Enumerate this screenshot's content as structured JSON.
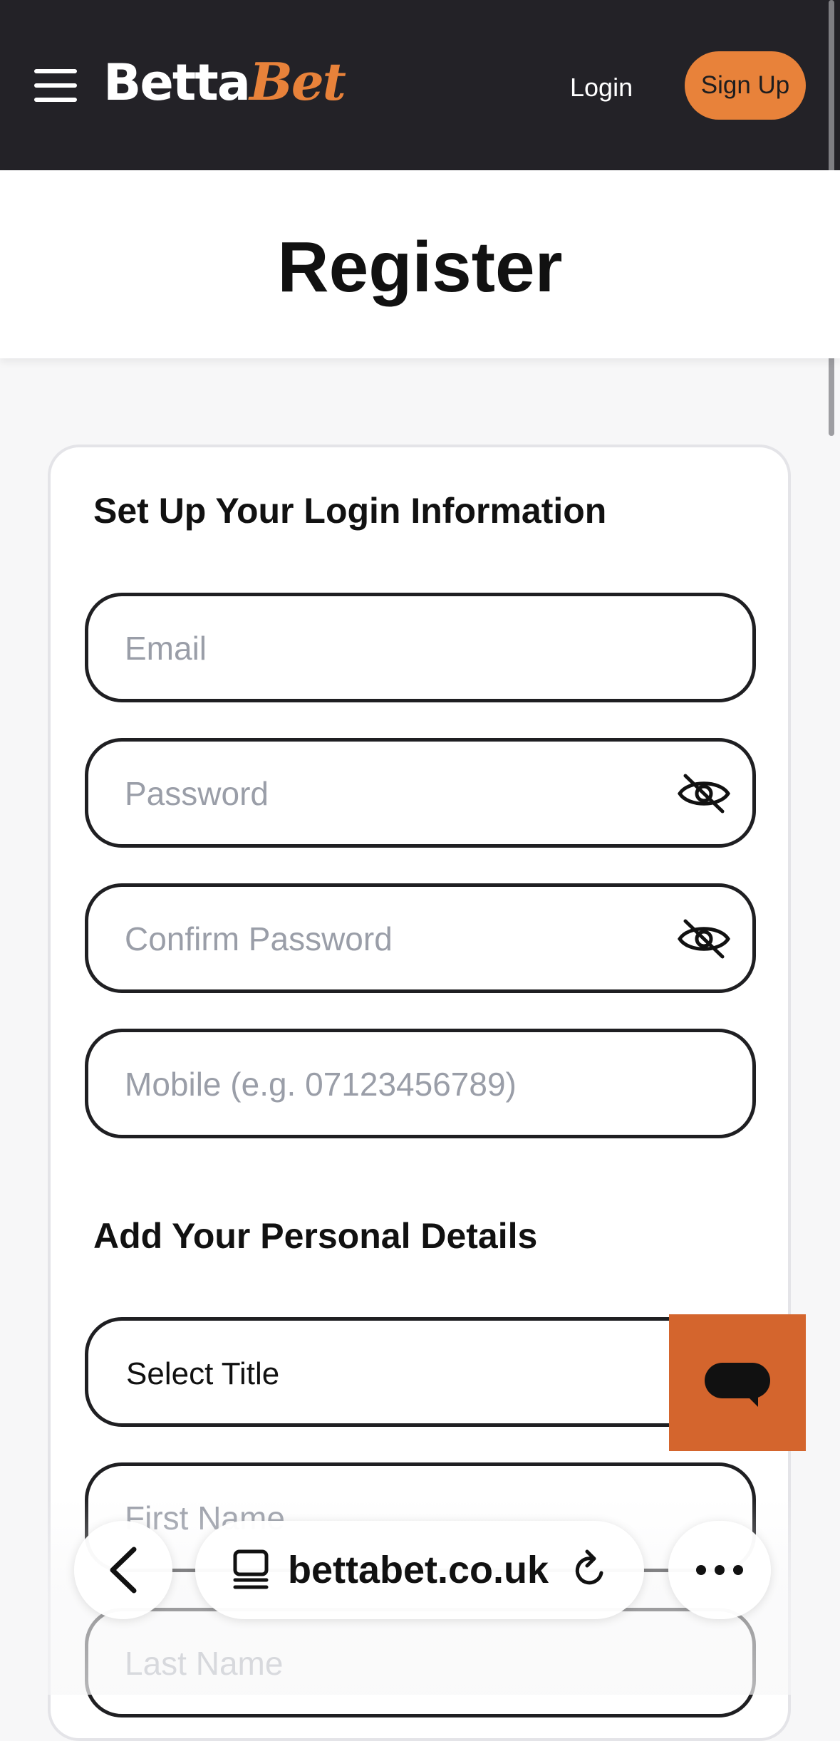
{
  "header": {
    "logo_part1": "Betta",
    "logo_part2": "Bet",
    "login_label": "Login",
    "signup_label": "Sign Up"
  },
  "page": {
    "title": "Register"
  },
  "login_section": {
    "title": "Set Up Your Login Information",
    "email_placeholder": "Email",
    "password_placeholder": "Password",
    "confirm_password_placeholder": "Confirm Password",
    "mobile_placeholder": "Mobile (e.g. 07123456789)"
  },
  "personal_section": {
    "title": "Add Your Personal Details",
    "title_select_value": "Select Title",
    "first_name_placeholder": "First Name",
    "last_name_placeholder": "Last Name"
  },
  "browser": {
    "url": "bettabet.co.uk"
  },
  "icons": {
    "menu": "menu-icon",
    "password_toggle": "eye-slash-icon",
    "chat": "chat-bubble-icon",
    "back": "chevron-left-icon",
    "tabs": "tabs-icon",
    "reload": "reload-icon",
    "more": "more-icon"
  },
  "colors": {
    "brand_orange": "#e8823a",
    "chat_orange": "#d4652d",
    "header_bg": "#232227"
  }
}
